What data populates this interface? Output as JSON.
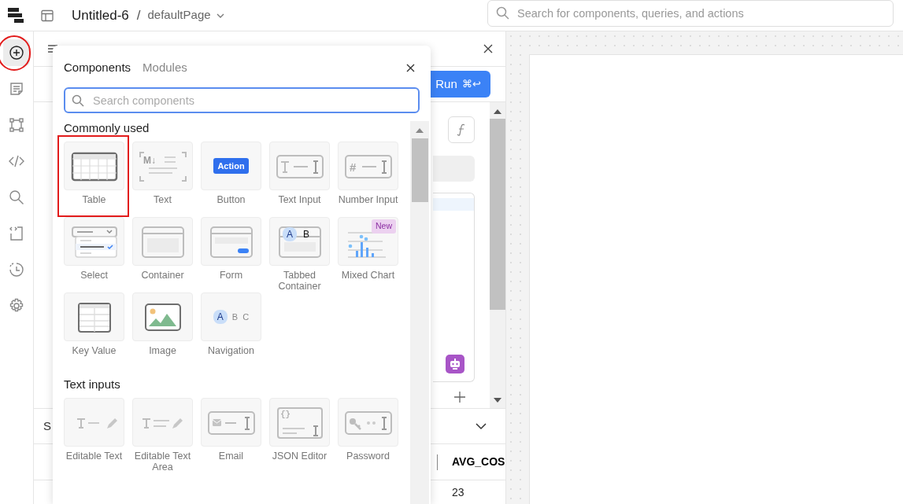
{
  "header": {
    "app_title": "Untitled-6",
    "separator": "/",
    "page": "defaultPage",
    "search": {
      "placeholder": "Search for components, queries, and actions"
    }
  },
  "rail": [
    {
      "selected": true,
      "circled": true
    },
    {
      "selected": false,
      "circled": false
    },
    {
      "selected": false,
      "circled": false
    },
    {
      "selected": false,
      "circled": false
    },
    {
      "selected": false,
      "circled": false
    },
    {
      "selected": false,
      "circled": false
    },
    {
      "selected": false,
      "circled": false
    },
    {
      "selected": false,
      "circled": false
    }
  ],
  "editor": {
    "section_letter": "S",
    "run_button": {
      "label": "Run",
      "shortcut": "⌘↩"
    },
    "column_header": "AVG_COS",
    "cell": "23"
  },
  "popup": {
    "tabs": [
      {
        "label": "Components",
        "selected": true
      },
      {
        "label": "Modules",
        "selected": false
      }
    ],
    "search": {
      "placeholder": "Search components"
    },
    "sections": [
      {
        "title": "Commonly used",
        "items": [
          {
            "label": "Table",
            "kind": "table",
            "highlighted": true
          },
          {
            "label": "Text",
            "kind": "markdown",
            "highlighted": false,
            "preview_text": [
              "M↓"
            ]
          },
          {
            "label": "Button",
            "kind": "button",
            "highlighted": false,
            "preview_text": [
              "Action"
            ]
          },
          {
            "label": "Text Input",
            "kind": "text_input",
            "highlighted": false
          },
          {
            "label": "Number Input",
            "kind": "number_input",
            "highlighted": false,
            "preview_text": [
              "#"
            ]
          },
          {
            "label": "Select",
            "kind": "select",
            "highlighted": false
          },
          {
            "label": "Container",
            "kind": "container",
            "highlighted": false
          },
          {
            "label": "Form",
            "kind": "form",
            "highlighted": false
          },
          {
            "label": "Tabbed Container",
            "kind": "tabbed",
            "highlighted": false,
            "preview_text": [
              "A",
              "B"
            ]
          },
          {
            "label": "Mixed Chart",
            "kind": "chart",
            "highlighted": false,
            "badge": "New"
          },
          {
            "label": "Key Value",
            "kind": "key_value",
            "highlighted": false
          },
          {
            "label": "Image",
            "kind": "image",
            "highlighted": false
          },
          {
            "label": "Navigation",
            "kind": "navigation",
            "highlighted": false,
            "preview_text": [
              "A",
              "B",
              "C"
            ]
          }
        ]
      },
      {
        "title": "Text inputs",
        "items": [
          {
            "label": "Editable Text",
            "kind": "editable_text",
            "highlighted": false
          },
          {
            "label": "Editable Text Area",
            "kind": "editable_text_area",
            "highlighted": false
          },
          {
            "label": "Email",
            "kind": "email",
            "highlighted": false
          },
          {
            "label": "JSON Editor",
            "kind": "json_editor",
            "highlighted": false,
            "preview_text": [
              "{}"
            ]
          },
          {
            "label": "Password",
            "kind": "password",
            "highlighted": false
          }
        ]
      }
    ]
  }
}
